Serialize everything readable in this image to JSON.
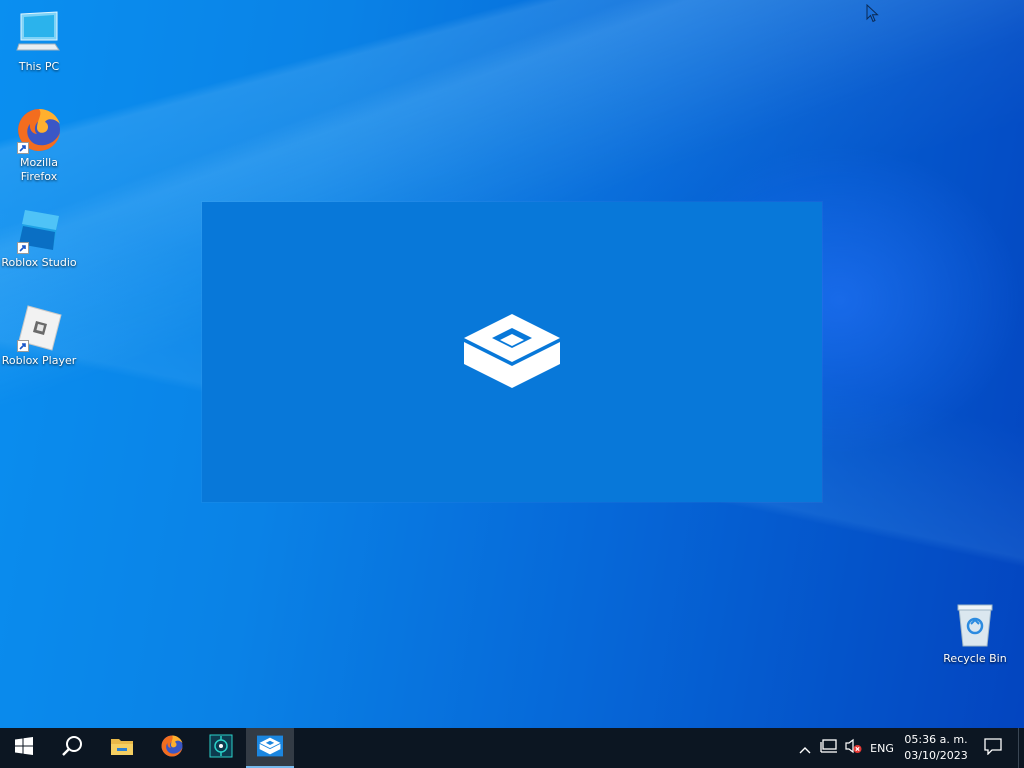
{
  "desktop": {
    "icons": [
      {
        "label": "This PC"
      },
      {
        "label": "Mozilla Firefox"
      },
      {
        "label": "Roblox Studio"
      },
      {
        "label": "Roblox Player"
      },
      {
        "label": "Recycle Bin"
      }
    ],
    "splash": {
      "icon": "sandbox-box-icon"
    }
  },
  "taskbar": {
    "buttons": [
      {
        "name": "start",
        "icon": "windows-logo-icon"
      },
      {
        "name": "search",
        "icon": "search-icon"
      },
      {
        "name": "file-explorer",
        "icon": "folder-icon"
      },
      {
        "name": "firefox",
        "icon": "firefox-icon"
      },
      {
        "name": "app",
        "icon": "app-icon"
      },
      {
        "name": "sandbox",
        "icon": "sandbox-box-icon",
        "active": true
      }
    ],
    "tray": {
      "language": "ENG",
      "time": "05:36 a. m.",
      "date": "03/10/2023"
    }
  },
  "colors": {
    "taskbar": "#0c1622",
    "splash": "#0878d9",
    "accent": "#76b9ed"
  }
}
